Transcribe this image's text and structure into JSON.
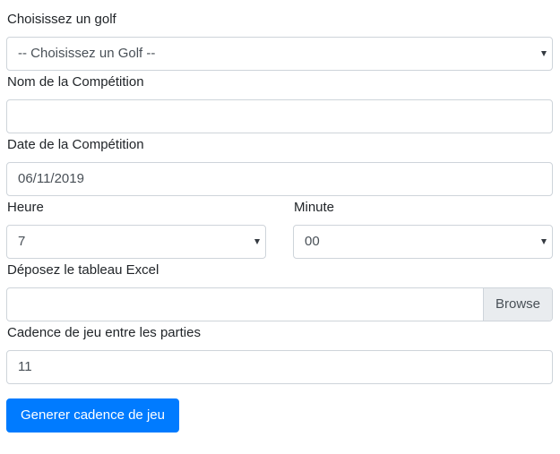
{
  "form": {
    "golf": {
      "label": "Choisissez un golf",
      "selected": "-- Choisissez un Golf --"
    },
    "competition_name": {
      "label": "Nom de la Compétition",
      "value": ""
    },
    "competition_date": {
      "label": "Date de la Compétition",
      "value": "06/11/2019"
    },
    "hour": {
      "label": "Heure",
      "selected": "7"
    },
    "minute": {
      "label": "Minute",
      "selected": "00"
    },
    "excel_file": {
      "label": "Déposez le tableau Excel",
      "value": "",
      "browse_label": "Browse"
    },
    "cadence": {
      "label": "Cadence de jeu entre les parties",
      "value": "11"
    },
    "submit_label": "Generer cadence de jeu"
  },
  "colors": {
    "primary": "#007bff",
    "border": "#ced4da",
    "browse_bg": "#e9ecef",
    "text": "#212529"
  },
  "icons": {
    "select_caret": "chevron-down-icon"
  }
}
